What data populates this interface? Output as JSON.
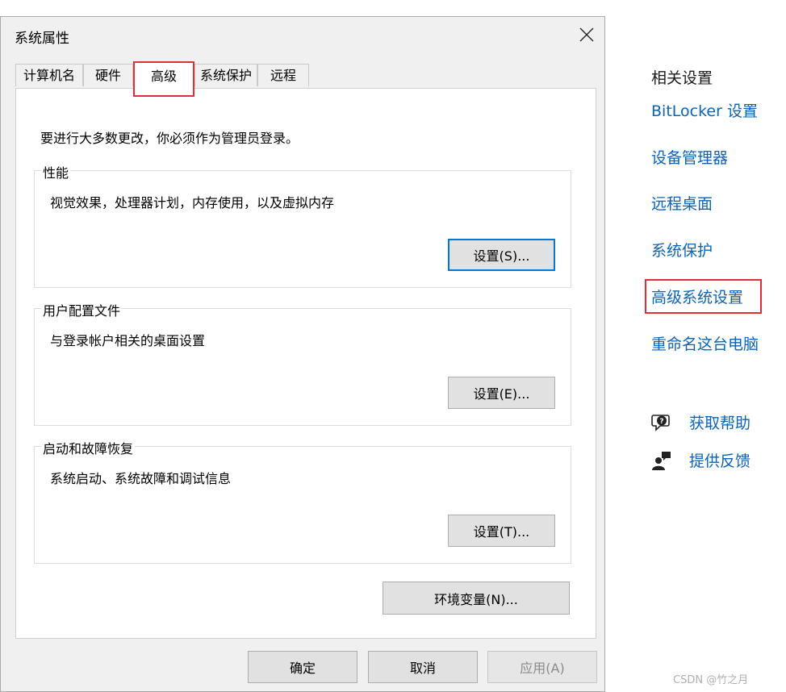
{
  "dialog": {
    "title": "系统属性",
    "tabs": [
      {
        "label": "计算机名",
        "active": false
      },
      {
        "label": "硬件",
        "active": false
      },
      {
        "label": "高级",
        "active": true
      },
      {
        "label": "系统保护",
        "active": false
      },
      {
        "label": "远程",
        "active": false
      }
    ],
    "intro": "要进行大多数更改，你必须作为管理员登录。",
    "groups": [
      {
        "title": "性能",
        "description": "视觉效果，处理器计划，内存使用，以及虚拟内存",
        "button": "设置(S)..."
      },
      {
        "title": "用户配置文件",
        "description": "与登录帐户相关的桌面设置",
        "button": "设置(E)..."
      },
      {
        "title": "启动和故障恢复",
        "description": "系统启动、系统故障和调试信息",
        "button": "设置(T)..."
      }
    ],
    "env_button": "环境变量(N)...",
    "footer": {
      "ok": "确定",
      "cancel": "取消",
      "apply": "应用(A)"
    }
  },
  "related": {
    "header": "相关设置",
    "links": [
      "BitLocker 设置",
      "设备管理器",
      "远程桌面",
      "系统保护",
      "高级系统设置",
      "重命名这台电脑"
    ],
    "highlighted_link": "高级系统设置",
    "help": [
      {
        "label": "获取帮助",
        "icon": "help-chat-icon"
      },
      {
        "label": "提供反馈",
        "icon": "feedback-icon"
      }
    ]
  },
  "watermark": "CSDN @竹之月",
  "colors": {
    "link": "#0a63b8",
    "highlight": "#e02e35",
    "focus": "#0078d7"
  }
}
